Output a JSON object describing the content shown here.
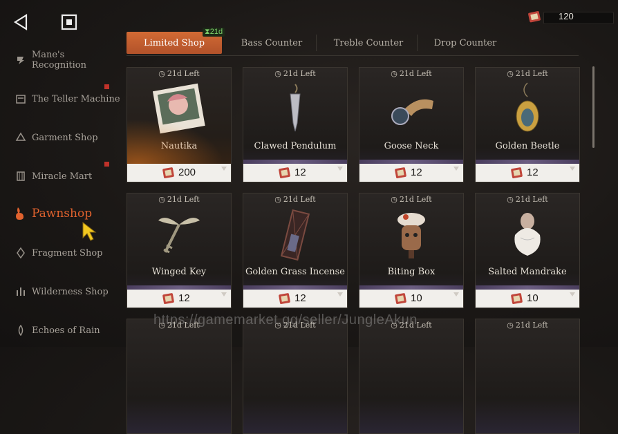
{
  "currency": {
    "value": "120"
  },
  "sidebar": {
    "items": [
      {
        "label": "Mane's Recognition",
        "icon": "mane-icon",
        "dot": false
      },
      {
        "label": "The Teller Machine",
        "icon": "teller-icon",
        "dot": true
      },
      {
        "label": "Garment Shop",
        "icon": "garment-icon",
        "dot": false
      },
      {
        "label": "Miracle Mart",
        "icon": "miracle-icon",
        "dot": true
      },
      {
        "label": "Pawnshop",
        "icon": "pawnshop-icon",
        "dot": false,
        "active": true
      },
      {
        "label": "Fragment Shop",
        "icon": "fragment-icon",
        "dot": false
      },
      {
        "label": "Wilderness Shop",
        "icon": "wilderness-icon",
        "dot": false
      },
      {
        "label": "Echoes of Rain",
        "icon": "echoes-icon",
        "dot": false
      }
    ]
  },
  "tabs": [
    {
      "label": "Limited Shop",
      "badge": "21d",
      "active": true
    },
    {
      "label": "Bass Counter"
    },
    {
      "label": "Treble Counter"
    },
    {
      "label": "Drop Counter"
    }
  ],
  "items": [
    {
      "timer": "21d Left",
      "name": "Nautika",
      "price": "200",
      "icon": "nautika-photo-icon"
    },
    {
      "timer": "21d Left",
      "name": "Clawed Pendulum",
      "price": "12",
      "icon": "pendulum-icon"
    },
    {
      "timer": "21d Left",
      "name": "Goose Neck",
      "price": "12",
      "icon": "goose-neck-icon"
    },
    {
      "timer": "21d Left",
      "name": "Golden Beetle",
      "price": "12",
      "icon": "beetle-icon"
    },
    {
      "timer": "21d Left",
      "name": "Winged Key",
      "price": "12",
      "icon": "winged-key-icon"
    },
    {
      "timer": "21d Left",
      "name": "Golden Grass Incense",
      "price": "12",
      "icon": "incense-icon"
    },
    {
      "timer": "21d Left",
      "name": "Biting Box",
      "price": "10",
      "icon": "biting-box-icon"
    },
    {
      "timer": "21d Left",
      "name": "Salted Mandrake",
      "price": "10",
      "icon": "mandrake-icon"
    },
    {
      "timer": "21d Left"
    },
    {
      "timer": "21d Left"
    },
    {
      "timer": "21d Left"
    },
    {
      "timer": "21d Left"
    }
  ],
  "watermark": "https://gamemarket.gg/seller/JungleAkun",
  "colors": {
    "accent": "#d26a34",
    "active_text": "#e0622e",
    "badge": "#7fd06a",
    "dot": "#c0322a"
  }
}
